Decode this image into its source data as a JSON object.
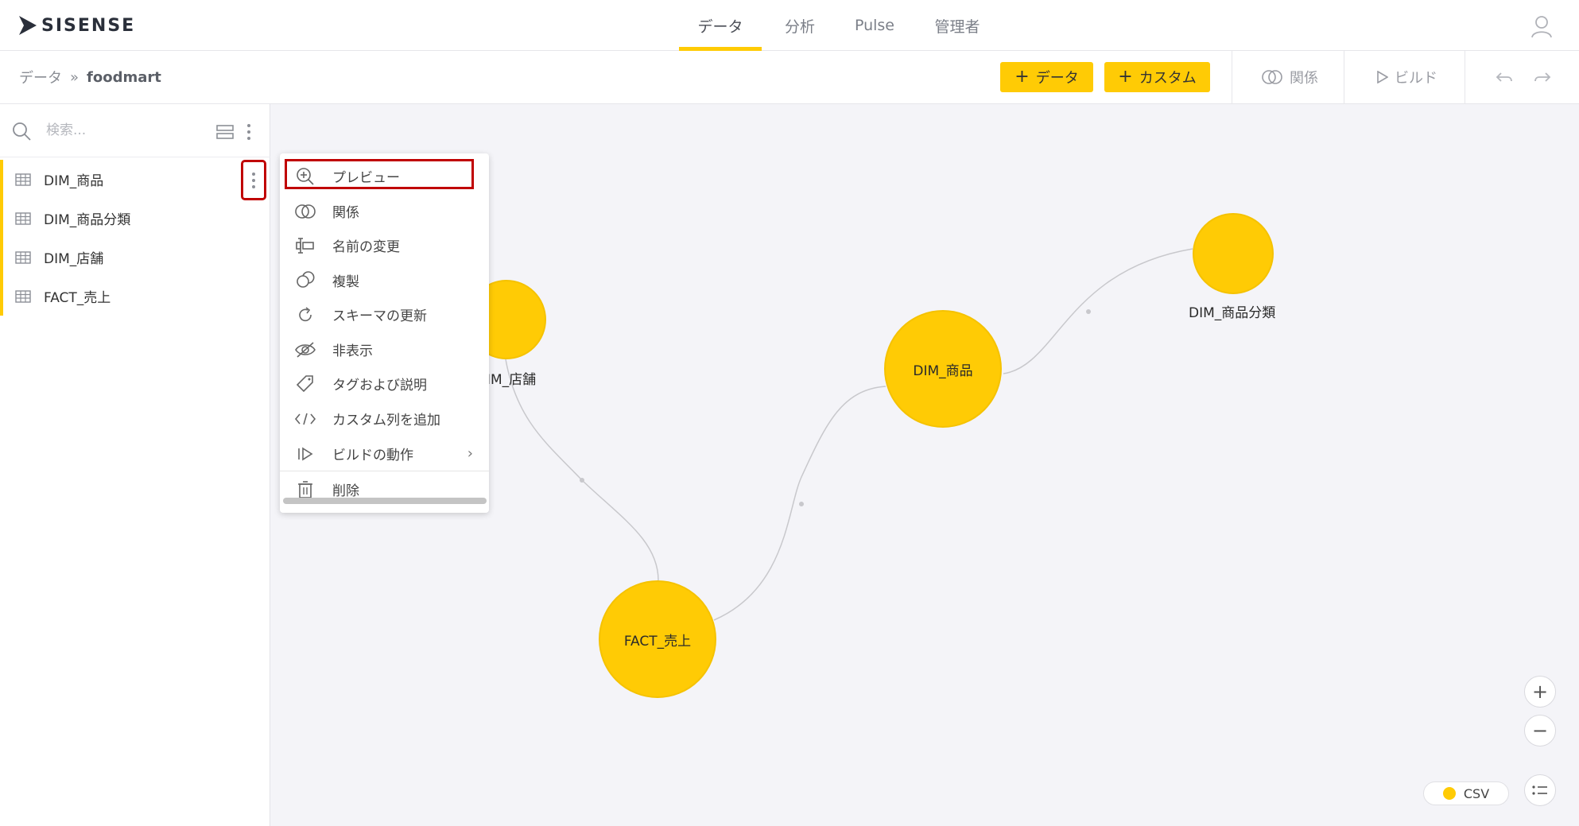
{
  "app": {
    "logo_text": "SISENSE"
  },
  "nav": {
    "tabs": [
      {
        "label": "データ",
        "active": true
      },
      {
        "label": "分析"
      },
      {
        "label": "Pulse"
      },
      {
        "label": "管理者"
      }
    ]
  },
  "breadcrumb": {
    "root": "データ",
    "separator": "»",
    "current": "foodmart"
  },
  "toolbar": {
    "add_data_label": "データ",
    "add_custom_label": "カスタム",
    "relations_label": "関係",
    "build_label": "ビルド"
  },
  "sidebar": {
    "search_placeholder": "検索...",
    "items": [
      {
        "label": "DIM_商品"
      },
      {
        "label": "DIM_商品分類"
      },
      {
        "label": "DIM_店舗"
      },
      {
        "label": "FACT_売上"
      }
    ]
  },
  "context_menu": {
    "items": [
      {
        "label": "プレビュー",
        "icon": "zoom-in-icon"
      },
      {
        "label": "関係",
        "icon": "relations-icon"
      },
      {
        "label": "名前の変更",
        "icon": "rename-icon"
      },
      {
        "label": "複製",
        "icon": "duplicate-icon"
      },
      {
        "label": "スキーマの更新",
        "icon": "refresh-icon"
      },
      {
        "label": "非表示",
        "icon": "hide-icon"
      },
      {
        "label": "タグおよび説明",
        "icon": "tag-icon"
      },
      {
        "label": "カスタム列を追加",
        "icon": "code-icon"
      },
      {
        "label": "ビルドの動作",
        "icon": "build-behavior-icon"
      },
      {
        "label": "削除",
        "icon": "trash-icon"
      }
    ]
  },
  "canvas": {
    "nodes": [
      {
        "label": "DIM_店舗",
        "visible_label": "IM_店舗"
      },
      {
        "label": "DIM_商品"
      },
      {
        "label": "DIM_商品分類"
      },
      {
        "label": "FACT_売上"
      }
    ],
    "legend": {
      "label": "CSV",
      "color": "#ffcb05"
    }
  },
  "colors": {
    "accent": "#ffcb05",
    "highlight": "#c00000"
  }
}
